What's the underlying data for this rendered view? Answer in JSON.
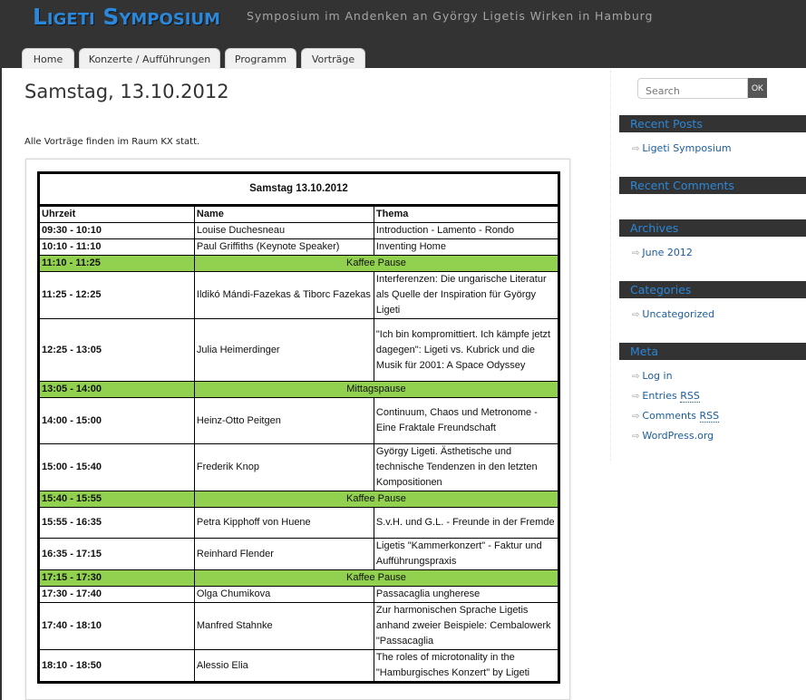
{
  "site": {
    "title": "Ligeti Symposium",
    "description": "Symposium im Andenken an György Ligetis Wirken in Hamburg"
  },
  "nav": {
    "tabs": [
      {
        "label": "Home"
      },
      {
        "label": "Konzerte / Aufführungen"
      },
      {
        "label": "Programm"
      },
      {
        "label": "Vorträge"
      }
    ]
  },
  "post": {
    "title": "Samstag, 13.10.2012",
    "intro": "Alle Vorträge finden im Raum KX statt."
  },
  "schedule": {
    "caption": "Samstag 13.10.2012",
    "headers": [
      "Uhrzeit",
      "Name",
      "Thema"
    ],
    "rows": [
      {
        "time": "09:30 - 10:10",
        "name": "Louise Duchesneau",
        "topic": "Introduction - Lamento - Rondo"
      },
      {
        "time": "10:10 - 11:10",
        "name": "Paul Griffiths (Keynote Speaker)",
        "topic": "Inventing Home"
      },
      {
        "time": "11:10 - 11:25",
        "pause": "Kaffee Pause"
      },
      {
        "time": "11:25 - 12:25",
        "name": "Ildikó Mándi-Fazekas & Tiborc Fazekas",
        "topic": "Interferenzen: Die ungarische Literatur als Quelle der Inspiration für György Ligeti"
      },
      {
        "time": "12:25 - 13:05",
        "name": "Julia Heimerdinger",
        "topic": "\"Ich bin kompromittiert. Ich kämpfe jetzt dagegen\": Ligeti vs. Kubrick und die Musik für 2001: A Space Odyssey"
      },
      {
        "time": "13:05 - 14:00",
        "pause": "Mittagspause"
      },
      {
        "time": "14:00 - 15:00",
        "name": "Heinz-Otto Peitgen",
        "topic": "Continuum, Chaos und Metronome - Eine Fraktale Freundschaft"
      },
      {
        "time": "15:00 - 15:40",
        "name": "Frederik Knop",
        "topic": "György Ligeti. Ästhetische und technische Tendenzen in den letzten Kompositionen"
      },
      {
        "time": "15:40 - 15:55",
        "pause": "Kaffee Pause"
      },
      {
        "time": "15:55 - 16:35",
        "name": "Petra Kipphoff von Huene",
        "topic": "S.v.H. und G.L. - Freunde in der Fremde"
      },
      {
        "time": "16:35 - 17:15",
        "name": "Reinhard Flender",
        "topic": "Ligetis \"Kammerkonzert\" - Faktur und Aufführungspraxis"
      },
      {
        "time": "17:15 - 17:30",
        "pause": "Kaffee Pause"
      },
      {
        "time": "17:30 - 17:40",
        "name": "Olga Chumikova",
        "topic": "Passacaglia ungherese"
      },
      {
        "time": "17:40 - 18:10",
        "name": "Manfred Stahnke",
        "topic": "Zur harmonischen Sprache Ligetis anhand zweier Beispiele: Cembalowerk \"Passacaglia"
      },
      {
        "time": "18:10 - 18:50",
        "name": "Alessio Elia",
        "topic": "The roles of microtonality in the \"Hamburgisches Konzert\" by Ligeti"
      }
    ]
  },
  "sidebar": {
    "search": {
      "placeholder": "Search",
      "button": "OK"
    },
    "recent_posts": {
      "title": "Recent Posts",
      "items": [
        "Ligeti Symposium"
      ]
    },
    "recent_comments": {
      "title": "Recent Comments"
    },
    "archives": {
      "title": "Archives",
      "items": [
        "June 2012"
      ]
    },
    "categories": {
      "title": "Categories",
      "items": [
        "Uncategorized"
      ]
    },
    "meta": {
      "title": "Meta",
      "items": [
        "Log in",
        "Entries",
        "Comments",
        "WordPress.org"
      ],
      "abbr": "RSS"
    }
  },
  "colors": {
    "accent": "#2b87d9",
    "pause_row": "#92d050",
    "header_bg": "#333333"
  }
}
